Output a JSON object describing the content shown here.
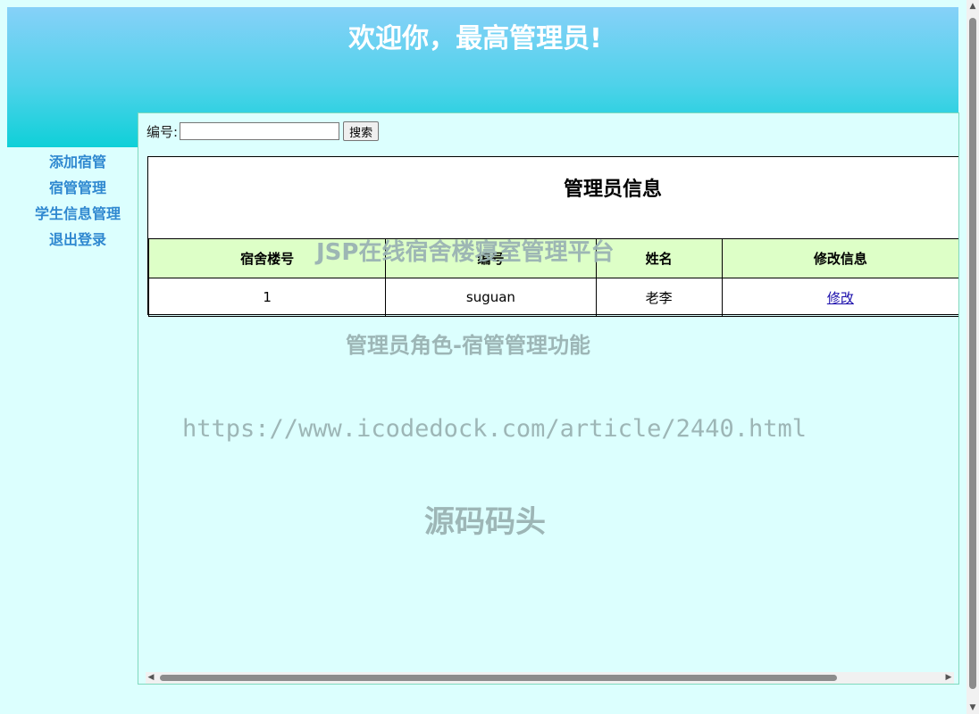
{
  "header": {
    "title": "欢迎你，最高管理员!"
  },
  "sidebar": {
    "items": [
      {
        "label": "添加宿管"
      },
      {
        "label": "宿管管理"
      },
      {
        "label": "学生信息管理"
      },
      {
        "label": "退出登录"
      }
    ]
  },
  "search": {
    "label": "编号:",
    "value": "",
    "placeholder": "",
    "button_label": "搜索"
  },
  "table": {
    "caption": "管理员信息",
    "headers": [
      "宿舍楼号",
      "编号",
      "姓名",
      "修改信息"
    ],
    "rows": [
      {
        "building": "1",
        "id": "suguan",
        "name": "老李",
        "action": "修改"
      }
    ]
  },
  "watermarks": {
    "line1": "JSP在线宿舍楼寝室管理平台",
    "line2": "管理员角色-宿管管理功能",
    "line3": "https://www.icodedock.com/article/2440.html",
    "line4": "源码码头"
  },
  "colors": {
    "page_bg": "#dcfffe",
    "header_gradient_top": "#86d1f8",
    "header_gradient_bottom": "#0fd0d8",
    "sidebar_link": "#2f88d0",
    "table_header_bg": "#ddffc7",
    "watermark": "#9ab3b3"
  },
  "icons": {
    "hscroll_left": "triangle-left-icon",
    "hscroll_right": "triangle-right-icon",
    "vscroll_up": "triangle-up-icon",
    "vscroll_down": "triangle-down-icon"
  }
}
